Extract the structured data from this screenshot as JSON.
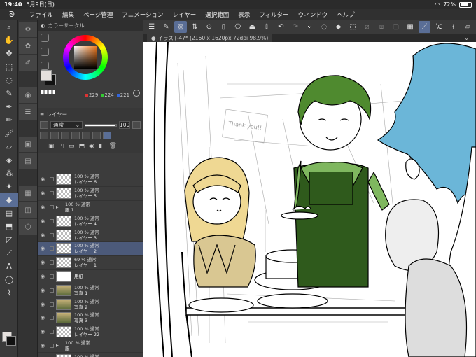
{
  "status": {
    "time": "19:40",
    "date": "5月9日(日)",
    "battery": "72%",
    "battery_level": 0.72
  },
  "menu": {
    "items": [
      "ファイル",
      "編集",
      "ページ管理",
      "アニメーション",
      "レイヤー",
      "選択範囲",
      "表示",
      "フィルター",
      "ウィンドウ",
      "ヘルプ"
    ]
  },
  "color_panel": {
    "title": "カラーサークル",
    "r": "229",
    "g": "224",
    "b": "221",
    "main_color": "#e5e0dd",
    "sub_color": "#111111"
  },
  "layers_panel": {
    "tab": "レイヤー",
    "blend_mode": "通常",
    "opacity": "100"
  },
  "layers": [
    {
      "opacity": "100 %  通常",
      "name": "レイヤー 6",
      "kind": "layer",
      "thumb": "trans"
    },
    {
      "opacity": "100 %  通常",
      "name": "レイヤー 5",
      "kind": "layer",
      "thumb": "trans"
    },
    {
      "opacity": "100 %  通常",
      "name": "服 1",
      "kind": "folder"
    },
    {
      "opacity": "100 %  通常",
      "name": "レイヤー 4",
      "kind": "layer",
      "thumb": "trans"
    },
    {
      "opacity": "100 %  通常",
      "name": "レイヤー 3",
      "kind": "layer",
      "thumb": "trans"
    },
    {
      "opacity": "100 %  通常",
      "name": "レイヤー 2",
      "kind": "layer",
      "thumb": "trans",
      "selected": true
    },
    {
      "opacity": "69 %  通常",
      "name": "レイヤー 1",
      "kind": "layer",
      "thumb": "trans"
    },
    {
      "opacity": "",
      "name": "用紙",
      "kind": "layer",
      "thumb": "white"
    },
    {
      "opacity": "100 %  通常",
      "name": "写真 1",
      "kind": "layer",
      "thumb": "photo"
    },
    {
      "opacity": "100 %  通常",
      "name": "写真 2",
      "kind": "layer",
      "thumb": "photo"
    },
    {
      "opacity": "100 %  通常",
      "name": "写真 3",
      "kind": "layer",
      "thumb": "photo"
    },
    {
      "opacity": "100 %  通常",
      "name": "レイヤー 22",
      "kind": "layer",
      "thumb": "trans"
    },
    {
      "opacity": "100 %  通常",
      "name": "服",
      "kind": "folder"
    },
    {
      "opacity": "100 %  通常",
      "name": "レイヤー 11",
      "kind": "layer",
      "thumb": "trans"
    }
  ],
  "canvas": {
    "tab_label": "イラスト47* (2160 x 1620px 72dpi 98.9%)",
    "sign_text": "Thank you!!"
  },
  "icons": {
    "tools": [
      "zoom-icon",
      "hand-icon",
      "move-icon",
      "select-icon",
      "lasso-icon",
      "eyedropper-icon",
      "pen-icon",
      "pencil-icon",
      "brush-icon",
      "eraser-icon",
      "fill-icon",
      "airbrush-icon",
      "decorate-icon",
      "fill-bucket-icon",
      "gradient-icon",
      "figure-icon",
      "frame-icon",
      "ruler-icon",
      "text-icon",
      "balloon-icon",
      "correction-icon"
    ]
  }
}
